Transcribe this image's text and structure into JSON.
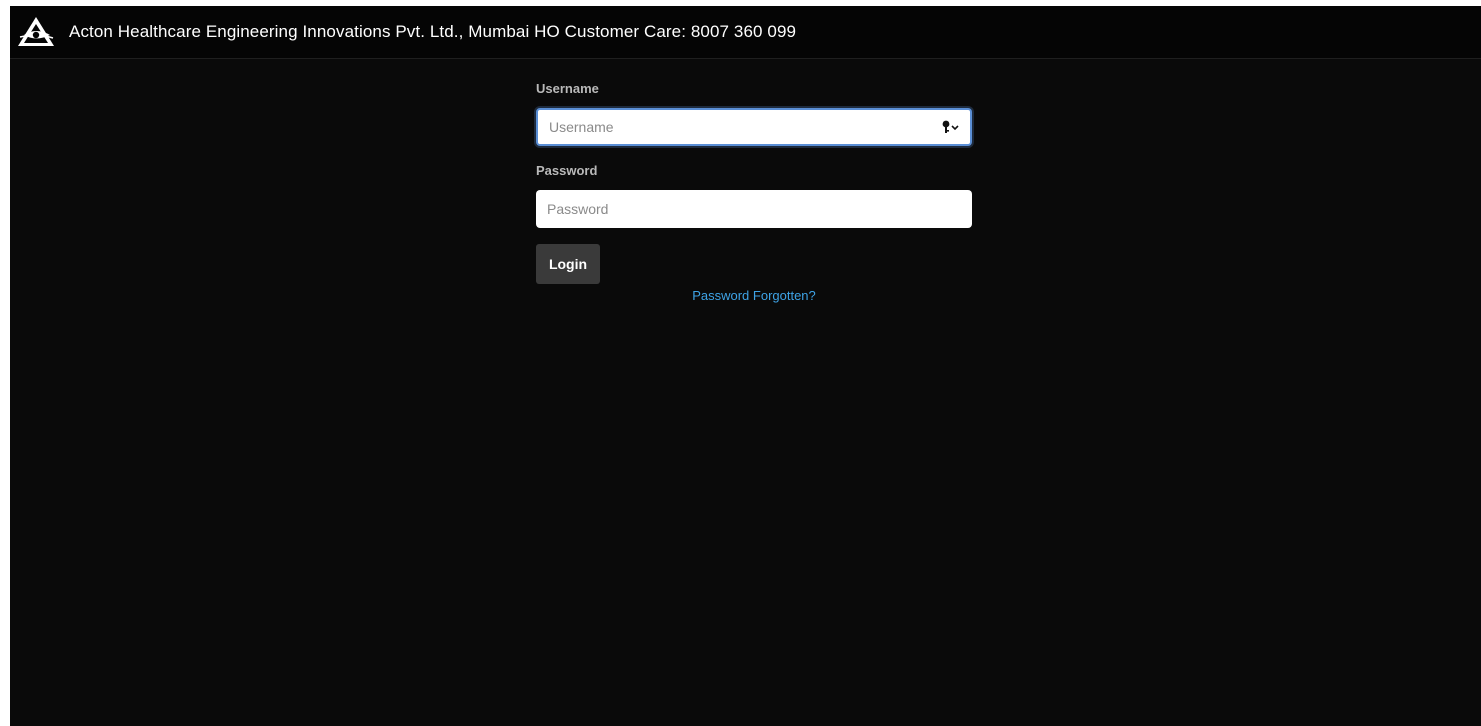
{
  "header": {
    "logo_icon": "eye-triangle-logo",
    "title": "Acton Healthcare Engineering Innovations Pvt. Ltd., Mumbai HO Customer Care: 8007 360 099"
  },
  "login_form": {
    "username": {
      "label": "Username",
      "placeholder": "Username",
      "value": "",
      "autofill_icon": "key-chevron-icon"
    },
    "password": {
      "label": "Password",
      "placeholder": "Password",
      "value": ""
    },
    "login_button_label": "Login",
    "forgot_link_label": "Password Forgotten?"
  },
  "colors": {
    "background": "#0a0a0a",
    "link": "#3ea3e6",
    "button": "#3a3a3a",
    "focus_ring": "#5b8fd6"
  }
}
